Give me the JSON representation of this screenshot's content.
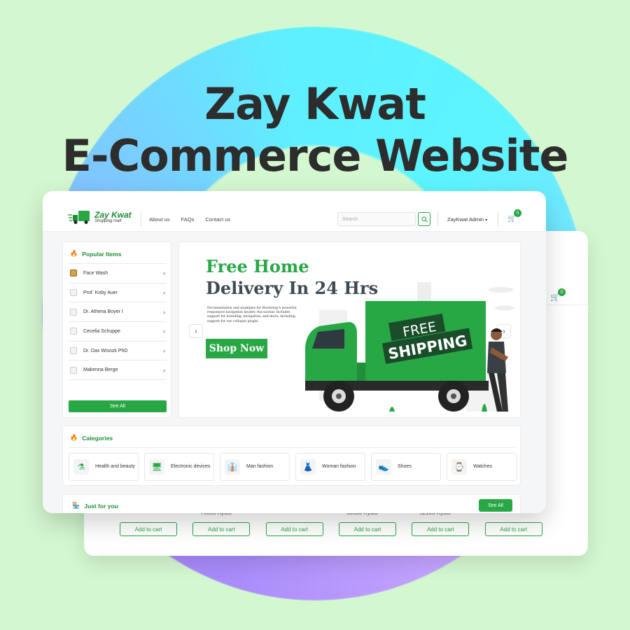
{
  "headline": {
    "line1": "Zay Kwat",
    "line2": "E-Commerce Website"
  },
  "navbar": {
    "logo_title": "Zay Kwat",
    "logo_subtitle": "Shopping mall",
    "links": [
      "About us",
      "FAQs",
      "Contact us"
    ],
    "search_placeholder": "Search",
    "admin_label": "ZayKwat Admin",
    "cart_count": "0"
  },
  "popular": {
    "title": "Popular Items",
    "items": [
      "Face Wash",
      "Prof. Koby Auer",
      "Dr. Athena Boyer I",
      "Cecelia Schuppe",
      "Dr. Dax Wisozk PhD",
      "Makenna Berge"
    ],
    "see_all": "See All"
  },
  "banner": {
    "line1": "Free Home",
    "line2": "Delivery In 24 Hrs",
    "description": "Documentation and examples for Bootstrap's powerful, responsive navigation header, the navbar. Includes support for branding, navigation, and more, including support for our collapse plugin.",
    "cta": "Shop Now",
    "truck_text1": "FREE",
    "truck_text2": "SHIPPING"
  },
  "categories": {
    "title": "Categories",
    "items": [
      {
        "label": "Health and beauty",
        "icon": "health-beauty-icon"
      },
      {
        "label": "Electronic devices",
        "icon": "electronic-devices-icon"
      },
      {
        "label": "Man fashion",
        "icon": "man-fashion-icon"
      },
      {
        "label": "Woman fashion",
        "icon": "woman-fashion-icon"
      },
      {
        "label": "Shoes",
        "icon": "shoes-icon"
      },
      {
        "label": "Watches",
        "icon": "watch-icon"
      }
    ]
  },
  "just_for_you": {
    "title": "Just for you",
    "see_all": "See All"
  },
  "back_screen": {
    "cart_count": "0",
    "products": [
      {
        "price": "",
        "button": "Add to cart"
      },
      {
        "price": "79300 Kyats",
        "button": "Add to cart"
      },
      {
        "price": "",
        "button": "Add to cart"
      },
      {
        "price": "58600 Kyats",
        "button": "Add to cart"
      },
      {
        "price": "52100 Kyats",
        "button": "Add to cart"
      },
      {
        "price": "",
        "button": "Add to cart"
      }
    ]
  },
  "colors": {
    "background": "#d3f7cf",
    "brand_green": "#28a745",
    "headline": "#2d2d2d"
  }
}
